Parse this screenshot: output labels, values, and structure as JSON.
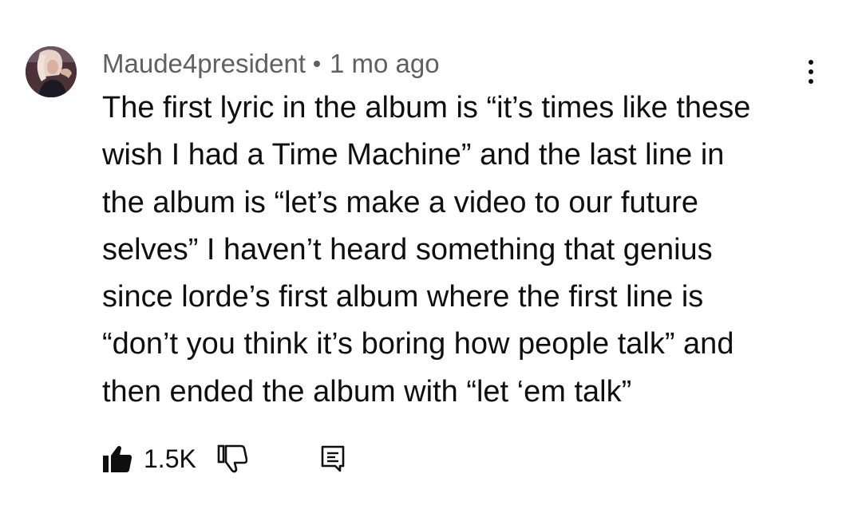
{
  "comment": {
    "author": "Maude4president",
    "separator": "•",
    "timestamp": "1 mo ago",
    "lines": [
      "The first lyric in the album is “it’s times like these",
      "wish I had a Time Machine” and the last line in",
      "the album is “let’s make a video to our future",
      "selves” I haven’t heard something that genius",
      "since lorde’s first album where the first line is",
      "“don’t you think it’s boring how people talk” and",
      "then ended the album with “let ‘em talk”"
    ],
    "like_count": "1.5K"
  },
  "icons": {
    "avatar": "avatar",
    "menu": "more-vert-icon",
    "like": "thumb-up-icon",
    "dislike": "thumb-down-icon",
    "reply": "comment-reply-icon"
  },
  "colors": {
    "text": "#0f0f0f",
    "meta": "#606060",
    "background": "#ffffff"
  }
}
